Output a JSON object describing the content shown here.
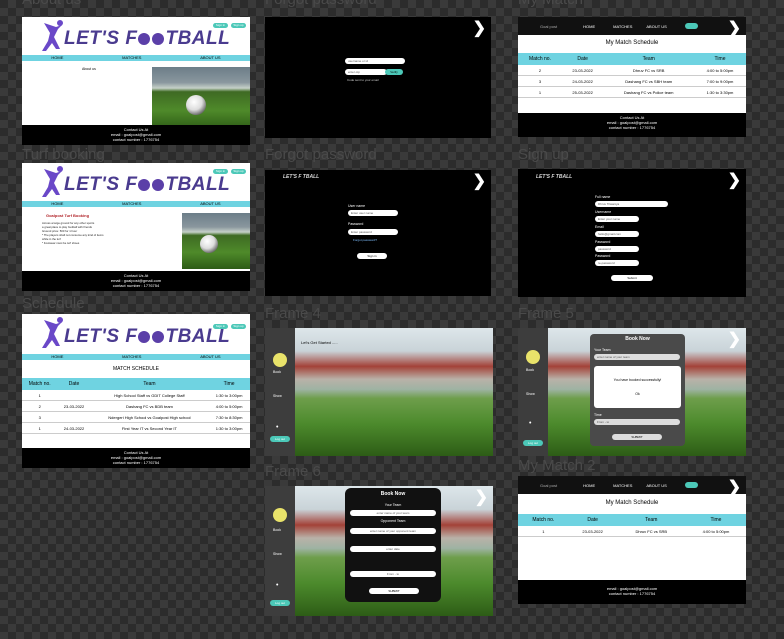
{
  "frame_labels": {
    "about": "About us",
    "forgot2": "Forgot password",
    "mymatch": "My Match",
    "booking": "Turf booking",
    "forgot": "Forgot password",
    "signup": "Sign up",
    "schedule": "Schedule",
    "frame4": "Frame 4",
    "frame5": "Frame 5",
    "frame6": "Frame 6",
    "mymatch2": "My Match 2"
  },
  "brand": {
    "logo_text_pre": "LET'S F",
    "logo_text_post": "TBALL"
  },
  "nav": {
    "home": "HOME",
    "matches": "MATCHES",
    "about": "ABOUT US",
    "signin": "Sign in",
    "signup": "Sign up"
  },
  "footer": {
    "contact": "Contact Us At",
    "email": "email : goalpost@gmail.com",
    "number": "contact number : 1776754"
  },
  "about": {
    "heading": "About us"
  },
  "forgot2": {
    "field1": "username or id",
    "field2": "enter otp",
    "verify": "Verify",
    "hint": "Code sent to your email"
  },
  "mymatch": {
    "logo": "Goal post",
    "title": "My Match Schedule",
    "headers": [
      "Match no.",
      "Date",
      "Team",
      "Time"
    ],
    "rows": [
      [
        "2",
        "23-03-2022",
        "Dhruv FC vs SRB",
        "4:00 to 5:00pm"
      ],
      [
        "3",
        "24-03-2022",
        "Dashang FC vs SBH team",
        "7:00 to 9:00pm"
      ],
      [
        "1",
        "25-03-2022",
        "Dashang FC vs Police team",
        "1:30 to 3:30pm"
      ]
    ],
    "contact": "Contact Us At",
    "email": "email : goalpost@gmail.com",
    "number": "contact number : 1776754"
  },
  "booking": {
    "title": "Goalpost Turf Booking",
    "lines": [
      "Across a large ground for any other sports",
      "a great place to play football with friends",
      "Ground price: 500 for 1 hour",
      "* The players shall not consume any kind of items",
      "  while in the turf",
      "* Footwear must be turf shoes"
    ]
  },
  "forgot": {
    "logo_text": "LET'S F  TBALL",
    "username_label": "User name",
    "username_ph": "Enter user name",
    "password_label": "Password",
    "password_ph": "Enter password",
    "forgot_link": "Forgot password?",
    "signin": "Sign in"
  },
  "signup": {
    "logo_text": "LET'S F  TBALL",
    "fields": [
      {
        "label": "Full name",
        "value": "Dhruv Tilwaniya"
      },
      {
        "label": "Username",
        "value": "Enter your name"
      },
      {
        "label": "Email",
        "value": "hello@gmail.com"
      },
      {
        "label": "Password",
        "value": "password"
      },
      {
        "label": "Password",
        "value": "re-password"
      }
    ],
    "submit": "Submit"
  },
  "schedule": {
    "title": "MATCH SCHEDULE",
    "headers": [
      "Match no.",
      "Date",
      "Team",
      "Time"
    ],
    "rows": [
      [
        "1",
        "",
        "High School Staff vs GDIT College Staff",
        "1:30 to 3:00pm"
      ],
      [
        "2",
        "23-03-2022",
        "Dashang FC vs BDB team",
        "4:00 to 5:00pm"
      ],
      [
        "3",
        "",
        "Ndergeri High School vs Goalpost High school",
        "7:30 to 8:30pm"
      ],
      [
        "1",
        "24-03-2022",
        "First Year IT vs Second Year IT",
        "1:30 to 3:00pm"
      ]
    ]
  },
  "frame4": {
    "start": "Let's Get Started .....",
    "side": [
      "Book",
      "Show"
    ],
    "logout": "Log out"
  },
  "frame5": {
    "side": [
      "Book",
      "Show"
    ],
    "logout": "Log out",
    "modal_title": "Book Now",
    "team_label": "Your Team",
    "team_ph": "enter name of your team",
    "success": "You have booked successfully!",
    "ok": "Ok",
    "time_label": "Time",
    "time_value": "From - to",
    "submit": "SUBMIT"
  },
  "frame6": {
    "side": [
      "Book",
      "Show"
    ],
    "logout": "Log out",
    "modal_title": "Book Now",
    "team_label": "Your Team",
    "team_ph": "enter name of your team",
    "opp_label": "Opponent Team",
    "opp_ph": "enter name of your opponent team",
    "date_ph": "enter date",
    "time_ph": "From - to",
    "submit": "SUBMIT"
  },
  "mymatch2": {
    "logo": "Goal post",
    "title": "My Match Schedule",
    "headers": [
      "Match no.",
      "Date",
      "Team",
      "Time"
    ],
    "rows": [
      [
        "1",
        "23-03-2022",
        "Dhruv FC vs SRB",
        "4:00 to 5:00pm"
      ]
    ],
    "email": "email : goalpost@gmail.com",
    "number": "contact number : 1776754"
  }
}
